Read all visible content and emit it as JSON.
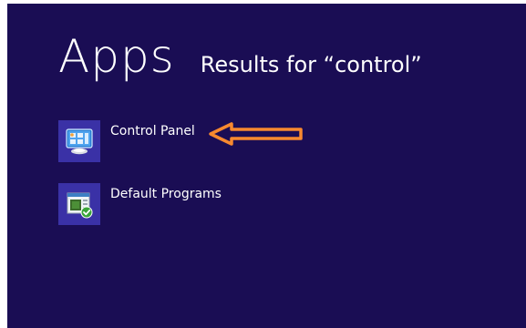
{
  "header": {
    "title": "Apps",
    "subtitle": "Results for “control”"
  },
  "results": [
    {
      "label": "Control Panel",
      "icon": "control-panel-icon"
    },
    {
      "label": "Default Programs",
      "icon": "default-programs-icon"
    }
  ],
  "annotation": {
    "icon": "arrow-left-icon",
    "color": "#f7892f"
  },
  "colors": {
    "background": "#1a0d54",
    "tile": "#3a31a6",
    "text": "#ffffff"
  }
}
